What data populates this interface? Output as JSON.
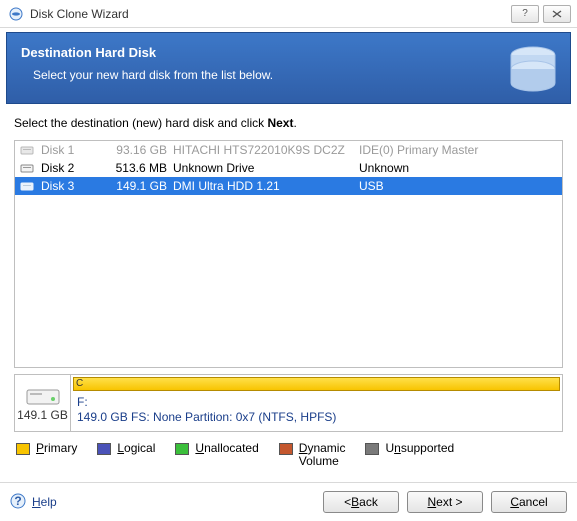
{
  "window": {
    "title": "Disk Clone Wizard"
  },
  "banner": {
    "heading": "Destination Hard Disk",
    "subtext": "Select your new hard disk from the list below."
  },
  "instruction": {
    "prefix": "Select the destination (new) hard disk and click ",
    "bold": "Next",
    "suffix": "."
  },
  "disks": [
    {
      "name": "Disk 1",
      "size": "93.16 GB",
      "model": "HITACHI HTS722010K9S DC2Z",
      "connection": "IDE(0) Primary Master",
      "state": "disabled"
    },
    {
      "name": "Disk 2",
      "size": "513.6 MB",
      "model": "Unknown Drive",
      "connection": "Unknown",
      "state": "normal"
    },
    {
      "name": "Disk 3",
      "size": "149.1 GB",
      "model": "DMI Ultra HDD 1.21",
      "connection": "USB",
      "state": "selected"
    }
  ],
  "preview": {
    "capacity": "149.1 GB",
    "bar_tag": "C",
    "drive_letter": "F:",
    "details": "149.0 GB  FS: None Partition: 0x7 (NTFS, HPFS)"
  },
  "legend": {
    "primary": "Primary",
    "logical": "Logical",
    "unallocated": "Unallocated",
    "dynamic_l1": "Dynamic",
    "dynamic_l2": "Volume",
    "unsupported": "Unsupported"
  },
  "help": "Help",
  "buttons": {
    "back": "Back",
    "next": "Next",
    "cancel": "Cancel"
  }
}
